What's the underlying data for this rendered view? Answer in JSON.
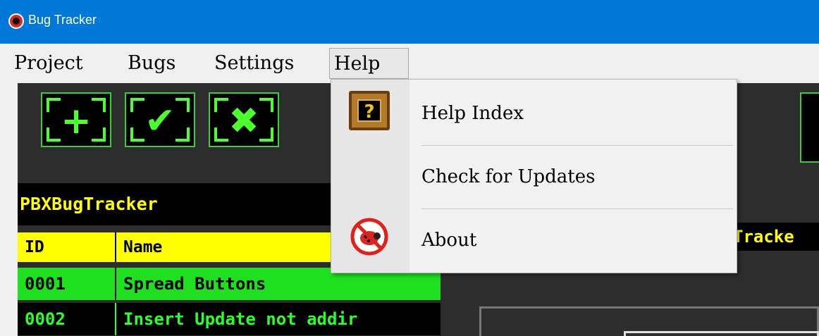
{
  "window": {
    "title": "Bug Tracker"
  },
  "menubar": {
    "items": [
      {
        "label": "Project"
      },
      {
        "label": "Bugs"
      },
      {
        "label": "Settings"
      },
      {
        "label": "Help",
        "open": true
      }
    ]
  },
  "toolbar": {
    "buttons": [
      {
        "icon": "plus-icon",
        "glyph": "+"
      },
      {
        "icon": "check-icon",
        "glyph": "✔"
      },
      {
        "icon": "x-icon",
        "glyph": "✖"
      }
    ]
  },
  "project": {
    "name": "PBXBugTracker"
  },
  "bug_table": {
    "columns": [
      "ID",
      "Name"
    ],
    "rows": [
      {
        "id": "0001",
        "name": "Spread Buttons"
      },
      {
        "id": "0002",
        "name": "Insert Update not addir"
      }
    ]
  },
  "detail_panel": {
    "title": "Tracke"
  },
  "help_menu": {
    "items": [
      {
        "label": "Help Index",
        "icon": "help-book-icon",
        "icon_glyph": "?"
      },
      {
        "label": "Check for Updates"
      },
      {
        "label": "About",
        "icon": "no-bugs-icon"
      }
    ]
  },
  "colors": {
    "titlebar": "#0078d7",
    "accent_green": "#4cff2f",
    "header_yellow": "#ffff00",
    "panel_dark": "#2d2d2d"
  }
}
